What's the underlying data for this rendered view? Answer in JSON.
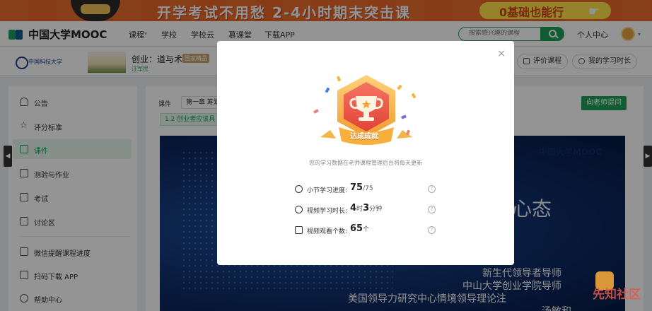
{
  "banner": {
    "headline": "开学考试不用愁 2-4小时期末突击课",
    "cta": "0基础也能行"
  },
  "nav": {
    "logo": "中国大学MOOC",
    "items": [
      "课程",
      "学校",
      "学校云",
      "慕课堂",
      "下载APP"
    ],
    "search_placeholder": "搜索感兴趣的课程",
    "user_center": "个人中心"
  },
  "course": {
    "school": "中国科技大学",
    "title": "创业：道与术",
    "badge": "国家精品",
    "teacher": "汪军民",
    "rate_button": "评价课程",
    "history_button": "我的学习时长"
  },
  "sidebar": {
    "items": [
      {
        "label": "公告",
        "icon": "bell-icon"
      },
      {
        "label": "评分标准",
        "icon": "star-icon"
      },
      {
        "label": "课件",
        "icon": "courseware-icon"
      },
      {
        "label": "测验与作业",
        "icon": "quiz-icon"
      },
      {
        "label": "考试",
        "icon": "exam-icon"
      },
      {
        "label": "讨论区",
        "icon": "discussion-icon"
      },
      {
        "label": "微信提醒课程进度",
        "icon": "hourglass-icon"
      },
      {
        "label": "扫码下载 APP",
        "icon": "qr-icon"
      },
      {
        "label": "帮助中心",
        "icon": "help-icon"
      }
    ],
    "active_index": 2
  },
  "content": {
    "crumb": "课件",
    "chapter": "第一章 筹划",
    "lesson": "1.2 创业者应该具",
    "ask_button": "向老师提问",
    "video": {
      "logo": "中国大学MOOC",
      "heading": "心态",
      "lines": [
        "新生代领导者导师",
        "中山大学创业学院导师",
        "美国领导力研究中心情境领导理论注",
        "汤敏和"
      ]
    }
  },
  "modal": {
    "close": "×",
    "badge_text": "达成成就",
    "note": "您的学习数据在老师课程管理后台将每天更新",
    "stats": [
      {
        "label": "小节学习进度:",
        "value": "75",
        "suffix": "/75",
        "icon": "progress-icon"
      },
      {
        "label": "视频学习时长:",
        "value_a": "4",
        "unit_a": "时",
        "value_b": "3",
        "unit_b": "分钟",
        "icon": "clock-icon"
      },
      {
        "label": "视频观看个数:",
        "value": "65",
        "suffix": "个",
        "icon": "video-icon"
      }
    ]
  },
  "watermark": "先知社区",
  "colors": {
    "accent": "#1f9f5b",
    "banner": "#ea6a2a",
    "badge_red": "#e65a4d",
    "badge_gold": "#f4b43b"
  }
}
